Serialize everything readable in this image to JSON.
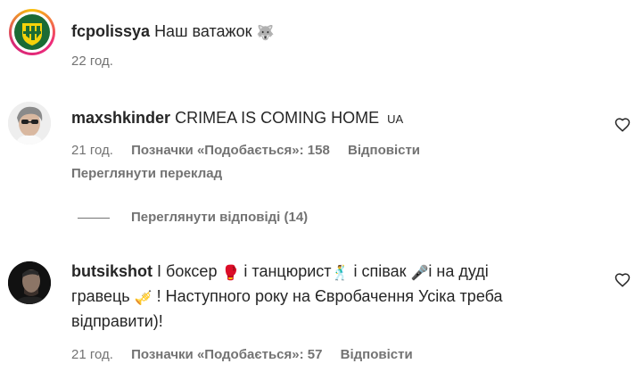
{
  "comments": [
    {
      "username": "fcpolissya",
      "text": "Наш ватажок",
      "emoji_after": "🐺",
      "time": "22 год."
    },
    {
      "username": "maxshkinder",
      "text": "CRIMEA IS COMING HOME",
      "flag_tag": "UA",
      "time": "21 год.",
      "likes": "Позначки «Подобається»: 158",
      "reply": "Відповісти",
      "see_translation": "Переглянути переклад",
      "view_replies": "Переглянути відповіді (14)"
    },
    {
      "username": "butsikshot",
      "line1_a": "І боксер",
      "emoji1": "🥊",
      "line1_b": "і танцюрист",
      "emoji2": "🕺",
      "line1_c": "і співак",
      "emoji3": "🎤",
      "line1_d": "і на дуді",
      "line2_a": "гравець",
      "emoji4": "🎺",
      "line2_b": "! Наступного року на Євробачення Усіка треба",
      "line3": "відправити)!",
      "time": "21 год.",
      "likes": "Позначки «Подобається»: 57",
      "reply": "Відповісти"
    }
  ],
  "colors": {
    "text": "#262626",
    "secondary": "#737373",
    "polissya_yellow": "#f5d20a",
    "polissya_green": "#1b6b34"
  },
  "icons": [
    "heart-outline-icon",
    "polissya-logo",
    "avatar"
  ]
}
